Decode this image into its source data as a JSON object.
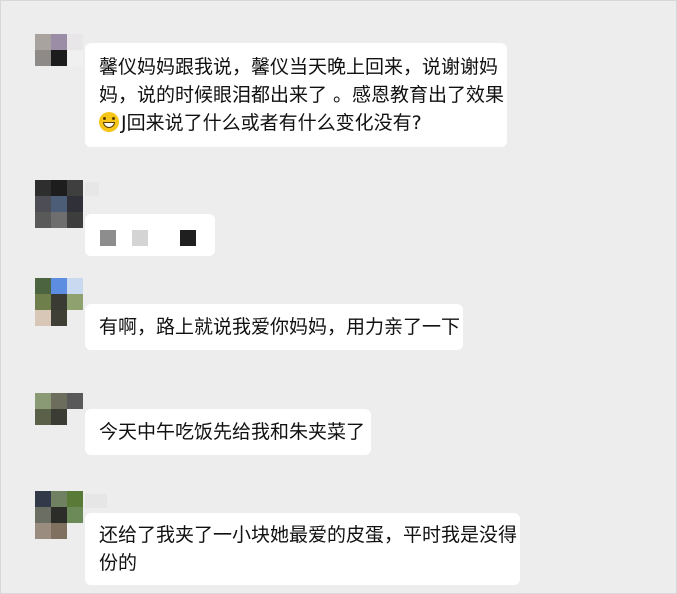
{
  "conversation": {
    "messages": [
      {
        "sender": "mosaic-avatar-1",
        "lines": [
          "馨仪妈妈跟我说，馨仪当天晚上回来，说谢谢妈",
          "妈，说的时候眼泪都出来了 。感恩教育出了效果",
          "J回来说了什么或者有什么变化没有?"
        ],
        "emoji": "grinning-face-icon"
      },
      {
        "sender": "mosaic-avatar-2",
        "lines": [],
        "redacted": true
      },
      {
        "sender": "mosaic-avatar-3",
        "lines": [
          "有啊，路上就说我爱你妈妈，用力亲了一下"
        ]
      },
      {
        "sender": "mosaic-avatar-4",
        "lines": [
          "今天中午吃饭先给我和朱夹菜了"
        ]
      },
      {
        "sender": "mosaic-avatar-5",
        "lines": [
          "还给了我夹了一小块她最爱的皮蛋，平时我是没得",
          "份的"
        ]
      }
    ]
  },
  "colors": {
    "background": "#ededed",
    "bubble": "#ffffff",
    "text": "#111111"
  }
}
